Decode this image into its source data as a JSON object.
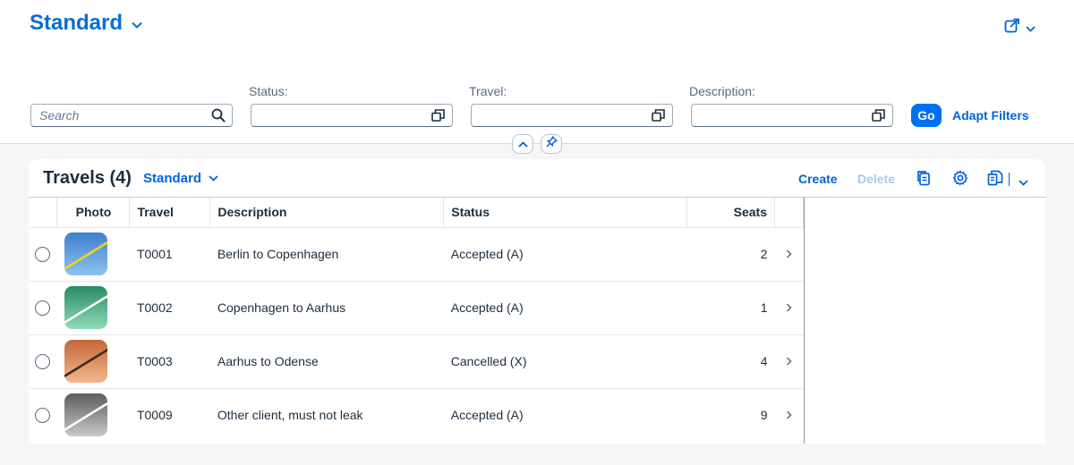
{
  "header": {
    "variant_title": "Standard"
  },
  "filters": {
    "search_placeholder": "Search",
    "status_label": "Status:",
    "travel_label": "Travel:",
    "description_label": "Description:",
    "go_label": "Go",
    "adapt_label": "Adapt Filters"
  },
  "table": {
    "title": "Travels (4)",
    "variant": "Standard",
    "create_label": "Create",
    "delete_label": "Delete",
    "columns": {
      "photo": "Photo",
      "travel": "Travel",
      "description": "Description",
      "status": "Status",
      "seats": "Seats"
    },
    "rows": [
      {
        "travel": "T0001",
        "description": "Berlin to Copenhagen",
        "status": "Accepted (A)",
        "seats": "2",
        "photo_colors": [
          "#3f7fcf",
          "#8fc3ee"
        ],
        "photo_stripe": "#f2d31e"
      },
      {
        "travel": "T0002",
        "description": "Copenhagen to Aarhus",
        "status": "Accepted (A)",
        "seats": "1",
        "photo_colors": [
          "#2a8a66",
          "#8fdcb6"
        ],
        "photo_stripe": "#ffffff"
      },
      {
        "travel": "T0003",
        "description": "Aarhus to Odense",
        "status": "Cancelled (X)",
        "seats": "4",
        "photo_colors": [
          "#c4673a",
          "#f2b88c"
        ],
        "photo_stripe": "#3a2a20"
      },
      {
        "travel": "T0009",
        "description": "Other client, must not leak",
        "status": "Accepted (A)",
        "seats": "9",
        "photo_colors": [
          "#5d5d60",
          "#c9c9cc"
        ],
        "photo_stripe": "#ffffff"
      }
    ]
  },
  "colors": {
    "accent": "#0064d9",
    "go_button": "#0070f2"
  }
}
